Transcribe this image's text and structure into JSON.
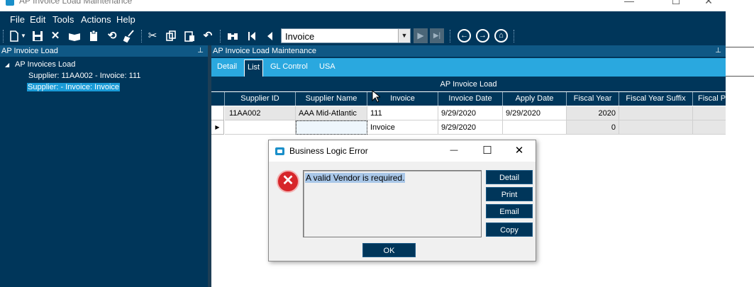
{
  "window": {
    "title": "AP Invoice Load Maintenance"
  },
  "menu": {
    "items": [
      "File",
      "Edit",
      "Tools",
      "Actions",
      "Help"
    ]
  },
  "toolbar": {
    "icons": [
      "new-icon",
      "save-icon",
      "delete-icon",
      "book-icon",
      "clipboard-icon",
      "refresh-icon",
      "clear-icon",
      "cut-icon",
      "copy-icon",
      "paste-icon",
      "undo-icon",
      "search-icon",
      "first-record-icon",
      "previous-record-icon"
    ],
    "nav_select_value": "Invoice",
    "nav_select_arrow": "▼",
    "next_label": "▶",
    "last_label": "▶|",
    "back_label": "←",
    "forward_label": "→",
    "home_label": "⌂"
  },
  "left_panel": {
    "header": "AP Invoice Load",
    "pin": "⊥",
    "tree": {
      "root": "AP Invoices Load",
      "expander": "◢",
      "children": [
        {
          "label": "Supplier: 11AA002 - Invoice: 111",
          "selected": false
        },
        {
          "label": "Supplier:  - Invoice: Invoice",
          "selected": true
        }
      ]
    }
  },
  "right_panel": {
    "header": "AP Invoice Load Maintenance",
    "pin": "⊥",
    "tabs": [
      {
        "label": "Detail",
        "active": false
      },
      {
        "label": "List",
        "active": true
      },
      {
        "label": "GL Control",
        "active": false
      },
      {
        "label": "USA",
        "active": false
      }
    ],
    "grid": {
      "caption": "AP Invoice Load",
      "columns": [
        "Supplier ID",
        "Supplier Name",
        "Invoice",
        "Invoice Date",
        "Apply Date",
        "Fiscal Year",
        "Fiscal Year Suffix",
        "Fiscal P"
      ],
      "rows": [
        {
          "indicator": "",
          "cells": [
            "11AA002",
            "AAA Mid-Atlantic",
            "111",
            "9/29/2020",
            "9/29/2020",
            "2020",
            "",
            ""
          ]
        },
        {
          "indicator": "▶",
          "cells": [
            "",
            "",
            "Invoice",
            "9/29/2020",
            "",
            "0",
            "",
            ""
          ]
        }
      ]
    }
  },
  "dialog": {
    "title": "Business Logic Error",
    "minimize": "—",
    "maximize": "☐",
    "close": "✕",
    "error_glyph": "✕",
    "message": "A valid Vendor is required.",
    "buttons": [
      "Detail",
      "Print",
      "Email",
      "Copy"
    ],
    "ok_label": "OK"
  },
  "titlebar_controls": {
    "minimize": "—",
    "maximize": "☐",
    "close": "✕"
  }
}
